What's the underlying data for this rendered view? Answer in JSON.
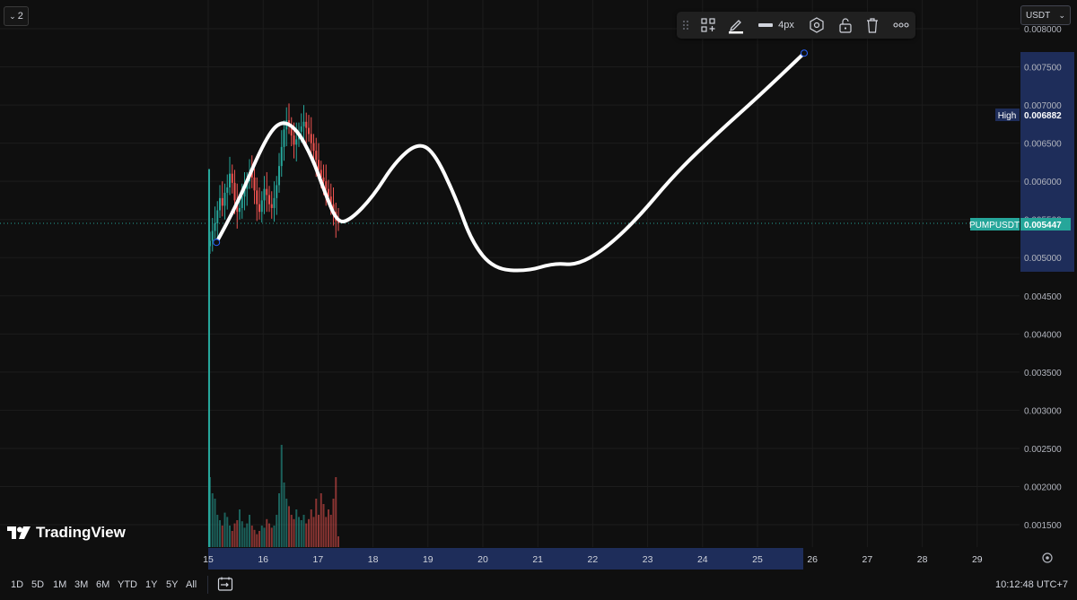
{
  "app": {
    "interval_badge": "2",
    "logo_text": "TradingView",
    "currency": "USDT",
    "clock": "10:12:48 UTC+7"
  },
  "toolbar": {
    "line_width_label": "4px",
    "icons": [
      "drag-handle-icon",
      "add-template-icon",
      "pencil-color-icon",
      "line-width-icon",
      "settings-hexagon-icon",
      "unlock-icon",
      "trash-icon",
      "more-icon"
    ]
  },
  "price_axis": {
    "ticks": [
      "0.008000",
      "0.007500",
      "0.007000",
      "0.006500",
      "0.006000",
      "0.005500",
      "0.005000",
      "0.004500",
      "0.004000",
      "0.003500",
      "0.003000",
      "0.002500",
      "0.002000",
      "0.001500"
    ],
    "high_label": "High",
    "high_value": "0.006882",
    "symbol_label": "PUMPUSDT",
    "last_price": "0.005447"
  },
  "time_axis": {
    "ticks": [
      "15",
      "16",
      "17",
      "18",
      "19",
      "20",
      "21",
      "22",
      "23",
      "24",
      "25",
      "26",
      "27",
      "28",
      "29"
    ]
  },
  "range_buttons": [
    "1D",
    "5D",
    "1M",
    "3M",
    "6M",
    "YTD",
    "1Y",
    "5Y",
    "All"
  ],
  "colors": {
    "background": "#0f0f0f",
    "up": "#26a69a",
    "down": "#ef5350",
    "highlight": "#1e2d5a",
    "drawing": "#ffffff"
  },
  "chart_data": {
    "type": "candlestick",
    "symbol": "PUMPUSDT",
    "ylim": [
      0.0012,
      0.008
    ],
    "x_ticks": [
      "15",
      "16",
      "17",
      "18",
      "19",
      "20",
      "21",
      "22",
      "23",
      "24",
      "25",
      "26",
      "27",
      "28",
      "29"
    ],
    "candles_close": [
      0.00522,
      0.00535,
      0.00545,
      0.00562,
      0.00578,
      0.00568,
      0.00585,
      0.00592,
      0.0061,
      0.00598,
      0.00575,
      0.0056,
      0.00565,
      0.0058,
      0.0059,
      0.006,
      0.00612,
      0.00605,
      0.00588,
      0.0057,
      0.0056,
      0.00575,
      0.0059,
      0.00582,
      0.0057,
      0.00565,
      0.00578,
      0.00595,
      0.0062,
      0.00645,
      0.00668,
      0.0068,
      0.00672,
      0.0066,
      0.00648,
      0.00655,
      0.00665,
      0.00672,
      0.00678,
      0.0067,
      0.00662,
      0.0065,
      0.0064,
      0.00628,
      0.00615,
      0.00605,
      0.006,
      0.0059,
      0.0058,
      0.0057,
      0.0056,
      0.00548,
      0.00545
    ],
    "volume_heights": [
      0.65,
      0.5,
      0.45,
      0.3,
      0.25,
      0.2,
      0.32,
      0.28,
      0.2,
      0.15,
      0.22,
      0.25,
      0.35,
      0.24,
      0.18,
      0.22,
      0.3,
      0.2,
      0.16,
      0.12,
      0.15,
      0.2,
      0.18,
      0.26,
      0.22,
      0.18,
      0.2,
      0.3,
      0.5,
      0.95,
      0.6,
      0.45,
      0.38,
      0.3,
      0.26,
      0.35,
      0.28,
      0.25,
      0.3,
      0.22,
      0.26,
      0.35,
      0.28,
      0.45,
      0.3,
      0.5,
      0.4,
      0.28,
      0.35,
      0.3,
      0.45,
      0.65,
      0.1
    ],
    "high": 0.006882,
    "last": 0.005447,
    "drawing_path": [
      [
        15.15,
        0.0052
      ],
      [
        15.5,
        0.00565
      ],
      [
        16.0,
        0.0065
      ],
      [
        16.3,
        0.0068
      ],
      [
        16.6,
        0.0067
      ],
      [
        16.9,
        0.0063
      ],
      [
        17.1,
        0.0059
      ],
      [
        17.35,
        0.00545
      ],
      [
        17.6,
        0.0055
      ],
      [
        18.0,
        0.0058
      ],
      [
        18.4,
        0.00625
      ],
      [
        18.8,
        0.0065
      ],
      [
        19.1,
        0.0064
      ],
      [
        19.5,
        0.0058
      ],
      [
        19.8,
        0.0052
      ],
      [
        20.2,
        0.00485
      ],
      [
        20.8,
        0.00482
      ],
      [
        21.3,
        0.00493
      ],
      [
        21.7,
        0.0049
      ],
      [
        22.2,
        0.0051
      ],
      [
        22.8,
        0.0055
      ],
      [
        23.5,
        0.0061
      ],
      [
        24.3,
        0.00665
      ],
      [
        25.0,
        0.0071
      ],
      [
        25.85,
        0.00768
      ]
    ]
  }
}
